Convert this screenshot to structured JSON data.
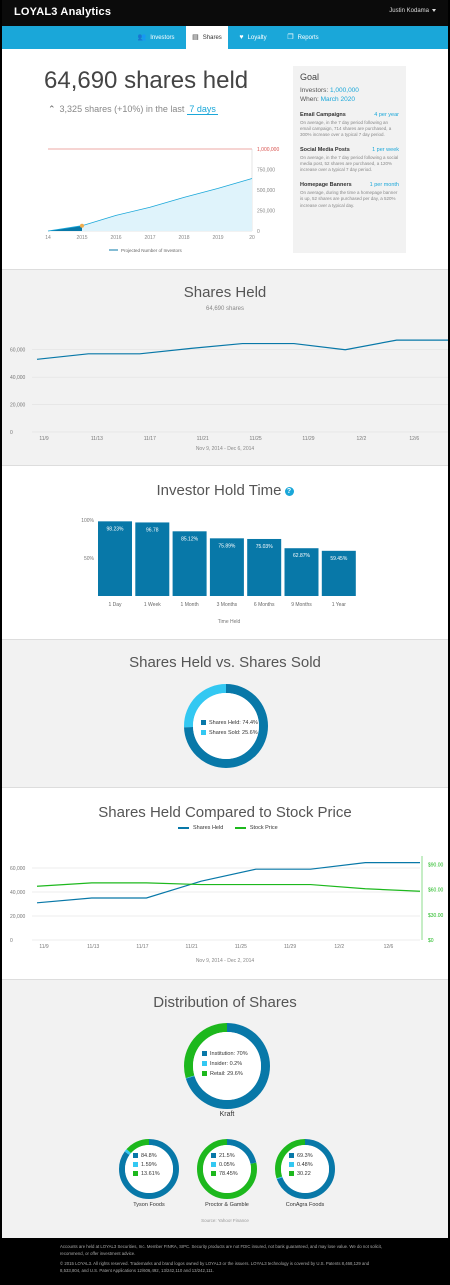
{
  "app": {
    "title": "LOYAL3 Analytics",
    "user": "Justin Kodama"
  },
  "nav": [
    {
      "label": "Investors",
      "icon": "users-icon",
      "glyph": "👥",
      "active": false
    },
    {
      "label": "Shares",
      "icon": "document-icon",
      "glyph": "▤",
      "active": true
    },
    {
      "label": "Loyalty",
      "icon": "heart-icon",
      "glyph": "♥",
      "active": false
    },
    {
      "label": "Reports",
      "icon": "copy-icon",
      "glyph": "❐",
      "active": false
    }
  ],
  "hero": {
    "shares_held": "64,690 shares held",
    "delta_text": "3,325 shares (+10%) in the last",
    "days": "7 days",
    "legend": "Projected Number of Investors"
  },
  "goal": {
    "title": "Goal",
    "investors_label": "Investors:",
    "investors_value": "1,000,000",
    "when_label": "When:",
    "when_value": "March 2020",
    "sections": [
      {
        "name": "Email Campaigns",
        "rate": "4 per year",
        "desc": "On average, in the 7 day period following an email campaign, 714 shares are purchased, a 300% increase over a typical 7 day period."
      },
      {
        "name": "Social Media Posts",
        "rate": "1 per week",
        "desc": "On average, in the 7 day period following a social media post, 52 shares are purchased, a 120% increase over a typical 7 day period."
      },
      {
        "name": "Homepage Banners",
        "rate": "1 per month",
        "desc": "On average, during the time a homepage banner is up, 52 shares are purchased per day, a 520% increase over a typical day."
      }
    ]
  },
  "shares_held": {
    "title": "Shares Held",
    "subtitle": "64,690 shares",
    "range": "Nov 9, 2014    -    Dec 6, 2014"
  },
  "hold_time": {
    "title": "Investor Hold Time",
    "xlabel": "Time Held"
  },
  "held_vs_sold": {
    "title": "Shares Held vs. Shares Sold",
    "held_label": "Shares Held:",
    "held_value": "74.4%",
    "sold_label": "Shares Sold:",
    "sold_value": "25.6%"
  },
  "compared": {
    "title": "Shares Held Compared to Stock Price",
    "legend_held": "Shares Held",
    "legend_price": "Stock Price",
    "range": "Nov 9, 2014    -    Dec 2, 2014"
  },
  "distribution": {
    "title": "Distribution of Shares",
    "main": {
      "name": "Kraft",
      "inst_label": "Institution:",
      "inst": "70%",
      "insider_label": "Insider:",
      "insider": "0.2%",
      "retail_label": "Retail:",
      "retail": "29.6%"
    },
    "companies": [
      {
        "name": "Tyson Foods",
        "a": "84.8%",
        "b": "1.59%",
        "c": "13.61%"
      },
      {
        "name": "Proctor & Gamble",
        "a": "21.5%",
        "b": "0.05%",
        "c": "78.45%"
      },
      {
        "name": "ConAgra Foods",
        "a": "69.3%",
        "b": "0.48%",
        "c": "30.22"
      }
    ],
    "source": "Source: Yahoo! Finance"
  },
  "footer": {
    "p1": "Accounts are held at LOYAL3 Securities, Inc. Member FINRA, SIPC. Security products are not FDIC insured, not bank guaranteed, and may lose value. We do not solicit, recommend, or offer investment advice.",
    "p2": "© 2015 LOYAL3. All rights reserved. Trademarks and brand logos owned by LOYAL3 or the issuers. LOYAL3 technology is covered by U.S. Patents 8,468,129 and 8,533,804, and U.S. Patent Applications 12/606,492, 13/242,110 and 13/242,111."
  },
  "colors": {
    "blue": "#1aa7d9",
    "dark_blue": "#0878a8",
    "green": "#1db81d",
    "light_blue": "#33c8f2",
    "red": "#d9534f"
  },
  "chart_data": [
    {
      "type": "area",
      "id": "projection",
      "x_ticks": [
        "14",
        "2015",
        "2016",
        "2017",
        "2018",
        "2019",
        "20"
      ],
      "y_ticks": [
        "1,000,000",
        "750,000",
        "500,000",
        "250,000",
        "0"
      ],
      "ylim": [
        0,
        1000000
      ],
      "goal_line": 1000000,
      "series": [
        {
          "name": "Projected Number of Investors",
          "x": [
            2014,
            2015,
            2016,
            2017,
            2018,
            2019,
            2020
          ],
          "values": [
            0,
            64690,
            190000,
            290000,
            410000,
            520000,
            640000
          ]
        }
      ]
    },
    {
      "type": "line",
      "id": "shares_held",
      "categories": [
        "11/9",
        "11/13",
        "11/17",
        "11/21",
        "11/25",
        "11/29",
        "12/2",
        "12/6"
      ],
      "y_ticks": [
        "60,000",
        "40,000",
        "20,000",
        "0"
      ],
      "ylim": [
        0,
        70000
      ],
      "series": [
        {
          "name": "Shares Held",
          "values": [
            53000,
            57000,
            57000,
            61000,
            64500,
            64500,
            60000,
            67000,
            67000
          ]
        }
      ]
    },
    {
      "type": "bar",
      "id": "hold_time",
      "categories": [
        "1 Day",
        "1 Week",
        "1 Month",
        "3 Months",
        "6 Months",
        "9 Months",
        "1 Year"
      ],
      "values": [
        98.23,
        96.78,
        85.12,
        75.89,
        75.03,
        62.87,
        59.45
      ],
      "labels": [
        "98.23%",
        "96.78",
        "85.12%",
        "75.89%",
        "75.03%",
        "62.87%",
        "59.45%"
      ],
      "y_ticks": [
        "100%",
        "50%"
      ],
      "ylim": [
        0,
        100
      ]
    },
    {
      "type": "pie",
      "id": "held_vs_sold",
      "categories": [
        "Shares Held",
        "Shares Sold"
      ],
      "values": [
        74.4,
        25.6
      ]
    },
    {
      "type": "line",
      "id": "compared",
      "categories": [
        "11/9",
        "11/13",
        "11/17",
        "11/21",
        "11/25",
        "11/29",
        "12/2",
        "12/6"
      ],
      "y_ticks_left": [
        "60,000",
        "40,000",
        "20,000",
        "0"
      ],
      "y_ticks_right": [
        "$90.00",
        "$60.00",
        "$30.00",
        "$0"
      ],
      "ylim": [
        0,
        70000
      ],
      "ylim_right": [
        0,
        100
      ],
      "series": [
        {
          "name": "Shares Held",
          "values": [
            31000,
            35000,
            35000,
            49000,
            59000,
            59000,
            64500,
            64500
          ]
        },
        {
          "name": "Stock Price",
          "values": [
            64,
            68,
            68,
            66,
            66,
            66,
            61,
            58
          ]
        }
      ]
    },
    {
      "type": "pie",
      "id": "distribution",
      "categories": [
        "Institution",
        "Insider",
        "Retail"
      ],
      "series": [
        {
          "name": "Kraft",
          "values": [
            70,
            0.2,
            29.6
          ]
        },
        {
          "name": "Tyson Foods",
          "values": [
            84.8,
            1.59,
            13.61
          ]
        },
        {
          "name": "Proctor & Gamble",
          "values": [
            21.5,
            0.05,
            78.45
          ]
        },
        {
          "name": "ConAgra Foods",
          "values": [
            69.3,
            0.48,
            30.22
          ]
        }
      ]
    }
  ]
}
